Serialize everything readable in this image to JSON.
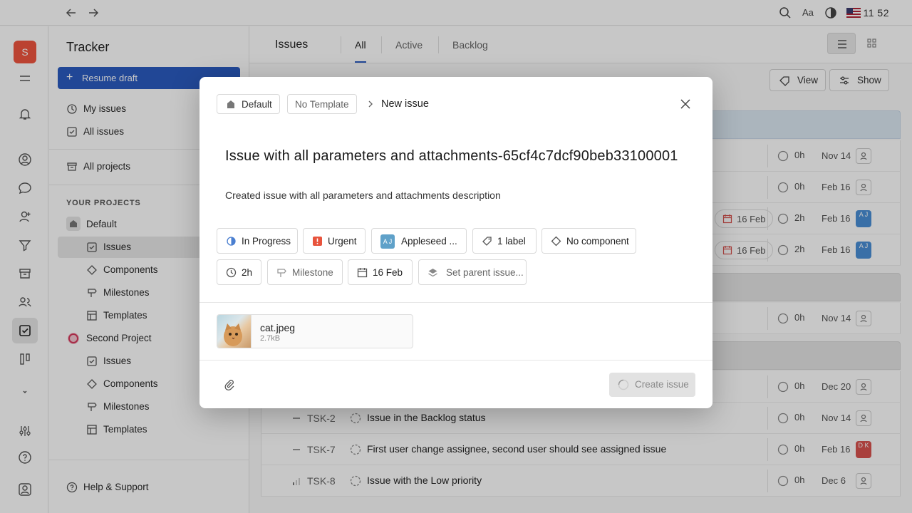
{
  "topbar": {
    "clock": "11 52",
    "font_label": "Aa"
  },
  "rail": {
    "workspace_initial": "S"
  },
  "sidebar": {
    "title": "Tracker",
    "resume_label": "Resume draft",
    "my_issues": "My issues",
    "all_issues": "All issues",
    "all_projects": "All projects",
    "section_label": "YOUR PROJECTS",
    "projects": [
      {
        "name": "Default",
        "items": [
          "Issues",
          "Components",
          "Milestones",
          "Templates"
        ]
      },
      {
        "name": "Second Project",
        "items": [
          "Issues",
          "Components",
          "Milestones",
          "Templates"
        ]
      }
    ],
    "help": "Help & Support"
  },
  "main": {
    "title": "Issues",
    "tabs": [
      "All",
      "Active",
      "Backlog"
    ],
    "view_label": "View",
    "show_label": "Show",
    "rows": [
      {
        "est": "0h",
        "due": "Nov 14"
      },
      {
        "est": "0h",
        "due": "Feb 16"
      },
      {
        "date_pill": "16 Feb",
        "est": "2h",
        "due": "Feb 16",
        "assignee": "A J"
      },
      {
        "date_pill": "16 Feb",
        "est": "2h",
        "due": "Feb 16",
        "assignee": "A J"
      },
      {
        "est": "0h",
        "due": "Nov 14"
      },
      {
        "est": "0h",
        "due": "Dec 20"
      },
      {
        "id": "TSK-2",
        "title": "Issue in the Backlog status",
        "est": "0h",
        "due": "Nov 14"
      },
      {
        "id": "TSK-7",
        "title": "First user change assignee, second user should see assigned issue",
        "est": "0h",
        "due": "Feb 16",
        "assignee": "D K"
      },
      {
        "id": "TSK-8",
        "title": "Issue with the Low priority",
        "est": "0h",
        "due": "Dec 6"
      }
    ],
    "colors": {
      "group_blue": "#dce8f3",
      "group_gray": "#e4e4e4",
      "avatar_blue": "#4a8fd6",
      "avatar_red": "#d9534f"
    }
  },
  "modal": {
    "project_chip": "Default",
    "template_chip": "No Template",
    "breadcrumb_current": "New issue",
    "issue_title": "Issue with all parameters and attachments-65cf4c7dcf90beb33100001",
    "issue_description": "Created issue with all parameters and attachments description",
    "params": {
      "status": "In Progress",
      "priority": "Urgent",
      "assignee_initials": "A J",
      "assignee": "Appleseed ...",
      "labels": "1 label",
      "component": "No component",
      "estimation": "2h",
      "milestone": "Milestone",
      "due_date": "16 Feb",
      "parent": "Set parent issue..."
    },
    "attachment": {
      "name": "cat.jpeg",
      "size": "2.7kB"
    },
    "create_label": "Create issue",
    "colors": {
      "urgent": "#e8543d",
      "assignee_avatar": "#5fa1c9",
      "status_progress": "#4a7fd0"
    }
  }
}
